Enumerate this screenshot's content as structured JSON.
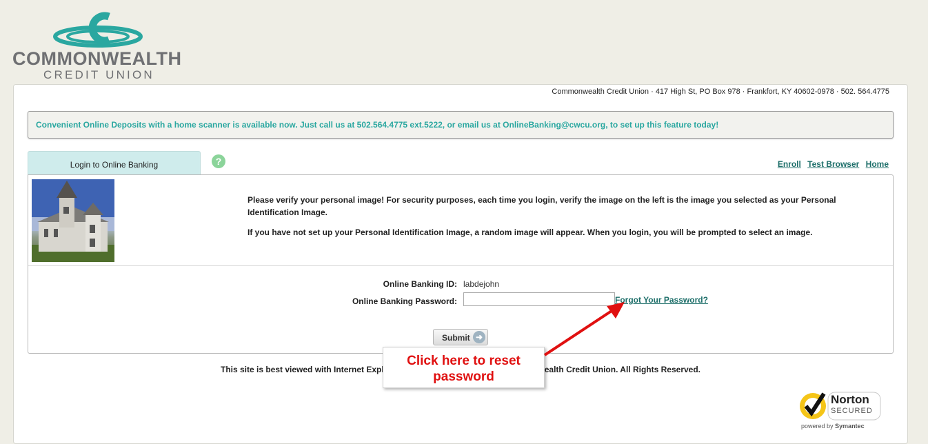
{
  "logo": {
    "name": "COMMONWEALTH",
    "subname": "CREDIT UNION",
    "colors": {
      "teal": "#2aa7a0",
      "gray": "#6f7073"
    }
  },
  "header": {
    "address": "Commonwealth Credit Union · 417 High St, PO Box 978 · Frankfort, KY 40602-0978 · 502. 564.4775"
  },
  "notice": {
    "text": "Convenient Online Deposits with a home scanner is available now. Just call us at 502.564.4775 ext.5222, or email us at OnlineBanking@cwcu.org, to set up this feature today!"
  },
  "tab": {
    "label": "Login to Online Banking"
  },
  "help_icon": {
    "glyph": "?",
    "icon": "help-icon"
  },
  "toplinks": [
    {
      "label": "Enroll"
    },
    {
      "label": "Test Browser"
    },
    {
      "label": "Home"
    }
  ],
  "verify": {
    "msg1": "Please verify your personal image! For security purposes, each time you login, verify the image on the left is the image you selected as your Personal Identification Image.",
    "msg2": "If you have not set up your Personal Identification Image, a random image will appear. When you login, you will be prompted to select an image."
  },
  "form": {
    "id_label": "Online Banking ID:",
    "id_value": "labdejohn",
    "password_label": "Online Banking Password:",
    "password_value": "",
    "forgot_label": "Forgot Your Password?",
    "submit_label": "Submit"
  },
  "footer": {
    "text_left": "This site is best viewed with Internet Expl",
    "text_right": "ealth Credit Union. All Rights Reserved."
  },
  "callout": {
    "line1": "Click here to reset",
    "line2": "password",
    "color": "#e01010"
  },
  "norton": {
    "brand": "Norton",
    "secured": "SECURED",
    "powered": "powered by",
    "symantec": "Symantec"
  }
}
